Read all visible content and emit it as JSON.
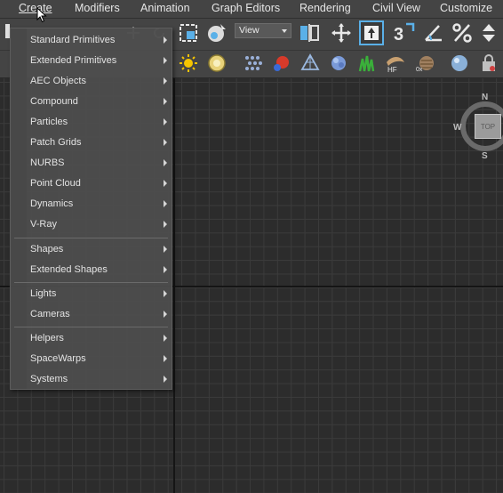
{
  "menubar": {
    "items": [
      {
        "label": "Create",
        "active": true
      },
      {
        "label": "Modifiers"
      },
      {
        "label": "Animation"
      },
      {
        "label": "Graph Editors"
      },
      {
        "label": "Rendering"
      },
      {
        "label": "Civil View"
      },
      {
        "label": "Customize"
      }
    ]
  },
  "toolbar": {
    "view_dropdown": "View",
    "icons_row1": [
      "select-region-icon",
      "select-object-icon",
      "view-dropdown",
      "mirror-icon",
      "move-icon",
      "select-and-link-icon",
      "snap-3d-icon",
      "angle-snap-icon",
      "percent-snap-icon",
      "spinner-snap-icon"
    ],
    "icons_row2": [
      "sun-icon",
      "sphere-light-icon",
      "particles-icon",
      "object-paint-icon",
      "plane-icon",
      "cloud-icon",
      "grass-icon",
      "hair-fur-icon",
      "displacement-icon",
      "sphere-material-icon",
      "lock-icon"
    ]
  },
  "viewcube": {
    "north": "N",
    "west": "W",
    "south": "S",
    "face": "TOP"
  },
  "create_menu": {
    "groups": [
      [
        {
          "label": "Standard Primitives"
        },
        {
          "label": "Extended Primitives"
        },
        {
          "label": "AEC Objects"
        },
        {
          "label": "Compound"
        },
        {
          "label": "Particles"
        },
        {
          "label": "Patch Grids"
        },
        {
          "label": "NURBS"
        },
        {
          "label": "Point Cloud"
        },
        {
          "label": "Dynamics"
        },
        {
          "label": "V-Ray"
        }
      ],
      [
        {
          "label": "Shapes"
        },
        {
          "label": "Extended Shapes"
        }
      ],
      [
        {
          "label": "Lights"
        },
        {
          "label": "Cameras"
        }
      ],
      [
        {
          "label": "Helpers"
        },
        {
          "label": "SpaceWarps"
        },
        {
          "label": "Systems"
        }
      ]
    ]
  },
  "colors": {
    "menubar_bg": "#444444",
    "viewport_bg": "#2c2c2c",
    "grid_line": "#3b3b3b",
    "menu_bg": "#4e4e4e"
  }
}
